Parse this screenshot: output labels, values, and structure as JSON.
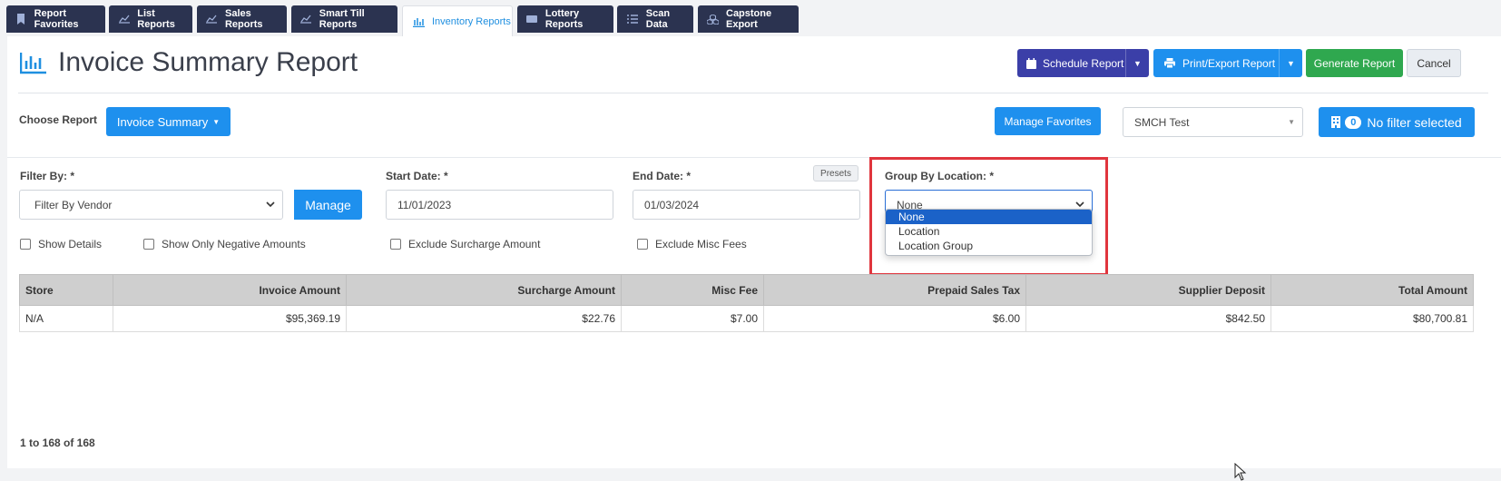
{
  "tabs": [
    {
      "label": "Report Favorites",
      "icon": "bookmark-icon"
    },
    {
      "label": "List Reports",
      "icon": "chart-line-icon"
    },
    {
      "label": "Sales Reports",
      "icon": "chart-line-icon"
    },
    {
      "label": "Smart Till Reports",
      "icon": "chart-line-icon"
    },
    {
      "label": "Inventory Reports",
      "icon": "bar-chart-icon"
    },
    {
      "label": "Lottery Reports",
      "icon": "ticket-icon"
    },
    {
      "label": "Scan Data",
      "icon": "list-icon"
    },
    {
      "label": "Capstone Export",
      "icon": "cubes-icon"
    }
  ],
  "active_tab": "Inventory Reports",
  "header": {
    "title": "Invoice Summary Report",
    "schedule_label": "Schedule Report",
    "print_label": "Print/Export Report",
    "generate_label": "Generate Report",
    "cancel_label": "Cancel"
  },
  "choose": {
    "label": "Choose Report",
    "report_label": "Invoice Summary",
    "manage_favorites_label": "Manage Favorites",
    "store_value": "SMCH Test",
    "filter_count": "0",
    "filter_label": "No filter selected"
  },
  "filters": {
    "filter_by_label": "Filter By: *",
    "filter_by_value": "Filter By Vendor",
    "manage_label": "Manage",
    "start_label": "Start Date: *",
    "start_value": "11/01/2023",
    "end_label": "End Date: *",
    "end_value": "01/03/2024",
    "presets_label": "Presets",
    "group_label": "Group By Location: *",
    "group_value": "None",
    "group_options": [
      "None",
      "Location",
      "Location Group"
    ]
  },
  "checkboxes": [
    "Show Details",
    "Show Only Negative Amounts",
    "Exclude Surcharge Amount",
    "Exclude Misc Fees"
  ],
  "table": {
    "headers": [
      "Store",
      "Invoice Amount",
      "Surcharge Amount",
      "Misc Fee",
      "Prepaid Sales Tax",
      "Supplier Deposit",
      "Total Amount"
    ],
    "rows": [
      [
        "N/A",
        "$95,369.19",
        "$22.76",
        "$7.00",
        "$6.00",
        "$842.50",
        "$80,700.81"
      ]
    ]
  },
  "pager": "1 to 168 of 168",
  "colors": {
    "navy_tab": "#2b3350",
    "accent_blue": "#1e90ee",
    "schedule": "#3b3fa8",
    "generate": "#2fa84f",
    "highlight": "#e0353d"
  }
}
